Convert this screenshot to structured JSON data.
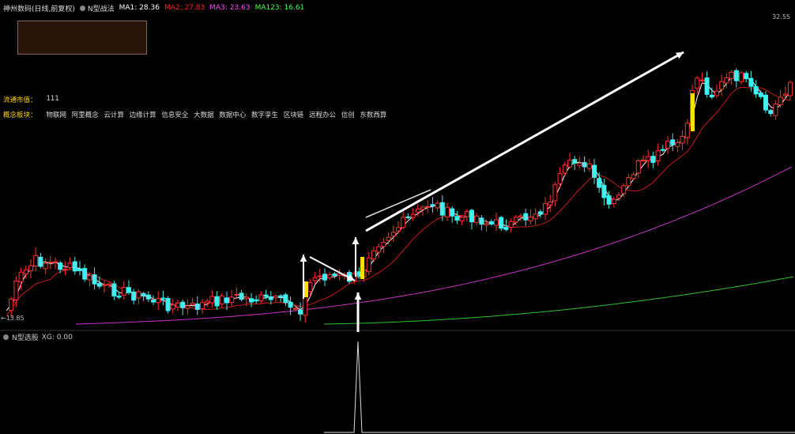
{
  "main_legend": {
    "stock_title": "神州数码(日线,前复权)",
    "indicator_name": "N型战法",
    "ma1": "MA1: 28.36",
    "ma2": "MA2: 27.83",
    "ma3": "MA3: 23.63",
    "ma123": "MA123: 16.61",
    "colors": {
      "ma1": "#ffffff",
      "ma2": "#ff2020",
      "ma3": "#ff40ff",
      "ma123": "#40ff40",
      "up": "#ff3030",
      "down": "#40f0f0",
      "signal": "#ffe000"
    }
  },
  "price_high_label": "32.55",
  "price_low_label": "13.85",
  "info": {
    "float_cap_label": "流通市值：",
    "float_cap_value": "111",
    "concept_label": "概念板块：",
    "concepts": [
      "物联网",
      "阿里概念",
      "云计算",
      "边缘计算",
      "信息安全",
      "大数据",
      "数据中心",
      "数字孪生",
      "区块链",
      "远程办公",
      "信创",
      "东数西算"
    ]
  },
  "sub_legend": {
    "indicator_name": "N型选股",
    "xg": "XG: 0.00"
  }
}
